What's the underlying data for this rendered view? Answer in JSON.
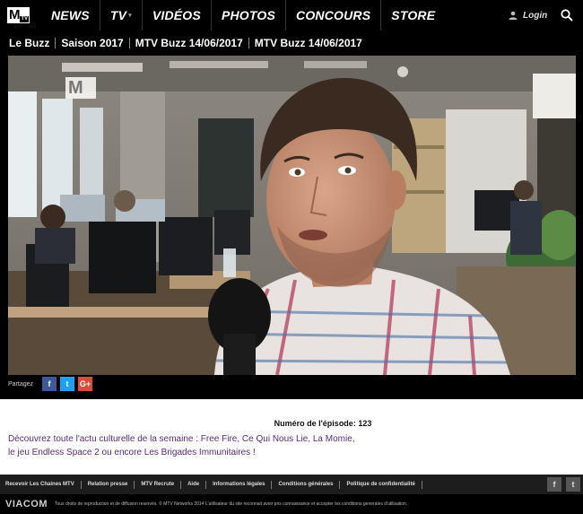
{
  "brand": {
    "logo_text": "M",
    "logo_sub": "TV"
  },
  "nav": {
    "items": [
      {
        "label": "NEWS"
      },
      {
        "label": "TV"
      },
      {
        "label": "VIDÉOS"
      },
      {
        "label": "PHOTOS"
      },
      {
        "label": "CONCOURS"
      },
      {
        "label": "STORE"
      }
    ],
    "tv_caret": "▾",
    "login_label": "Login"
  },
  "breadcrumb": [
    "Le Buzz",
    "Saison 2017",
    "MTV Buzz 14/06/2017",
    "MTV Buzz 14/06/2017"
  ],
  "video": {
    "watermark_text": "M"
  },
  "share": {
    "label": "Partagez",
    "buttons": [
      "f",
      "t",
      "G+"
    ]
  },
  "episode": {
    "text": "Numéro de l'épisode: 123"
  },
  "description": {
    "line1": "Découvrez toute l'actu culturelle de la semaine : Free Fire, Ce Qui Nous Lie, La Momie,",
    "line2": "le jeu Endless Space 2 ou encore Les Brigades Immunitaires !"
  },
  "footer": {
    "links": [
      "Recevoir Les Chaines MTV",
      "Relation presse",
      "MTV Recrute",
      "Aide",
      "Informations légales",
      "Conditions générales",
      "Politique de confidentialité"
    ],
    "social": [
      "f",
      "t"
    ]
  },
  "legal": {
    "brand": "VIACOM",
    "text": "Tous droits de reproduction et de diffusion reservés. © MTV Networks 2014 L'utilisateur du site reconnait avoir pris connaissance et accepter les conditions generales d'utilisation."
  },
  "colors": {
    "accent_link": "#5a2b7c",
    "nav_bg": "#000000",
    "facebook": "#3b5998",
    "twitter": "#1da1f2",
    "googleplus": "#dd4b39"
  }
}
